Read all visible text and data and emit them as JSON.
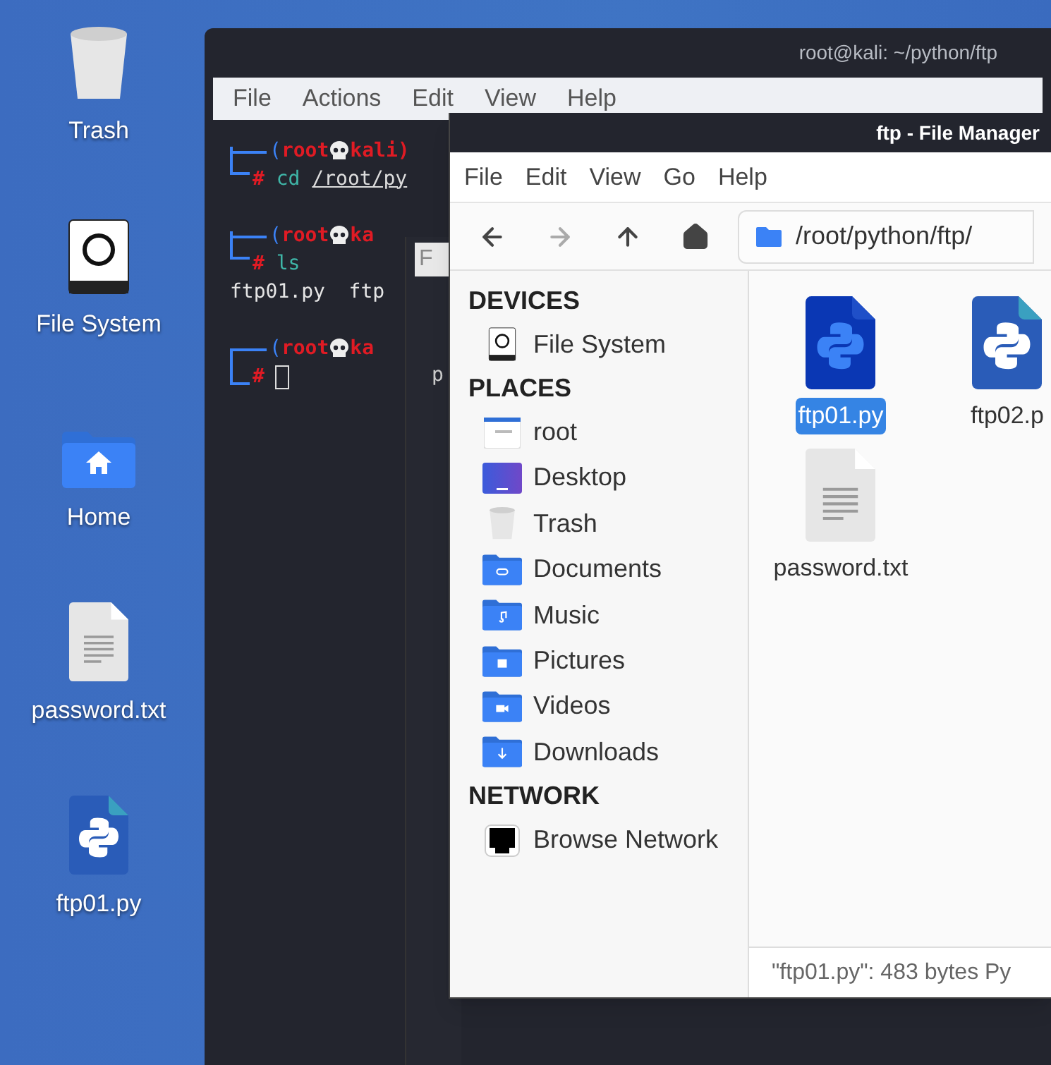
{
  "desktop_icons": [
    {
      "kind": "trash",
      "label": "Trash"
    },
    {
      "kind": "drive",
      "label": "File System"
    },
    {
      "kind": "home",
      "label": "Home"
    },
    {
      "kind": "text",
      "label": "password.txt"
    },
    {
      "kind": "python",
      "label": "ftp01.py"
    }
  ],
  "terminal": {
    "title": "root@kali: ~/python/ftp",
    "menu": [
      "File",
      "Actions",
      "Edit",
      "View",
      "Help"
    ],
    "lines": [
      {
        "kind": "prompt",
        "open": "(",
        "user": "root",
        "host": "kali)"
      },
      {
        "kind": "command",
        "sigil": "#",
        "command": "cd",
        "argument": "/root/py"
      },
      {
        "kind": "prompt",
        "open": "(",
        "user": "root",
        "host": "ka"
      },
      {
        "kind": "command",
        "sigil": "#",
        "command": "ls"
      },
      {
        "kind": "output",
        "text": "ftp01.py  ftp"
      },
      {
        "kind": "prompt",
        "open": "(",
        "user": "root",
        "host": "ka"
      },
      {
        "kind": "cursor",
        "sigil": "#"
      }
    ]
  },
  "middle_window": {
    "tab": "F",
    "text": "p"
  },
  "file_manager": {
    "title": "ftp - File Manager",
    "menu": [
      "File",
      "Edit",
      "View",
      "Go",
      "Help"
    ],
    "nav": [
      {
        "kind": "back",
        "disabled": false
      },
      {
        "kind": "forward",
        "disabled": true
      },
      {
        "kind": "up",
        "disabled": false
      },
      {
        "kind": "home",
        "disabled": false
      }
    ],
    "path": "/root/python/ftp/",
    "sidebar": [
      {
        "heading": "DEVICES",
        "items": [
          {
            "kind": "drive",
            "label": "File System"
          }
        ]
      },
      {
        "heading": "PLACES",
        "items": [
          {
            "kind": "home",
            "label": "root"
          },
          {
            "kind": "desktop",
            "label": "Desktop"
          },
          {
            "kind": "trash",
            "label": "Trash"
          },
          {
            "kind": "documents",
            "label": "Documents"
          },
          {
            "kind": "music",
            "label": "Music"
          },
          {
            "kind": "pictures",
            "label": "Pictures"
          },
          {
            "kind": "videos",
            "label": "Videos"
          },
          {
            "kind": "downloads",
            "label": "Downloads"
          }
        ]
      },
      {
        "heading": "NETWORK",
        "items": [
          {
            "kind": "network",
            "label": "Browse Network"
          }
        ]
      }
    ],
    "files": [
      {
        "kind": "python",
        "name": "ftp01.py",
        "selected": true
      },
      {
        "kind": "python",
        "name": "ftp02.p",
        "selected": false
      },
      {
        "kind": "text",
        "name": "password.txt",
        "selected": false
      }
    ],
    "status": "\"ftp01.py\": 483 bytes Py"
  }
}
